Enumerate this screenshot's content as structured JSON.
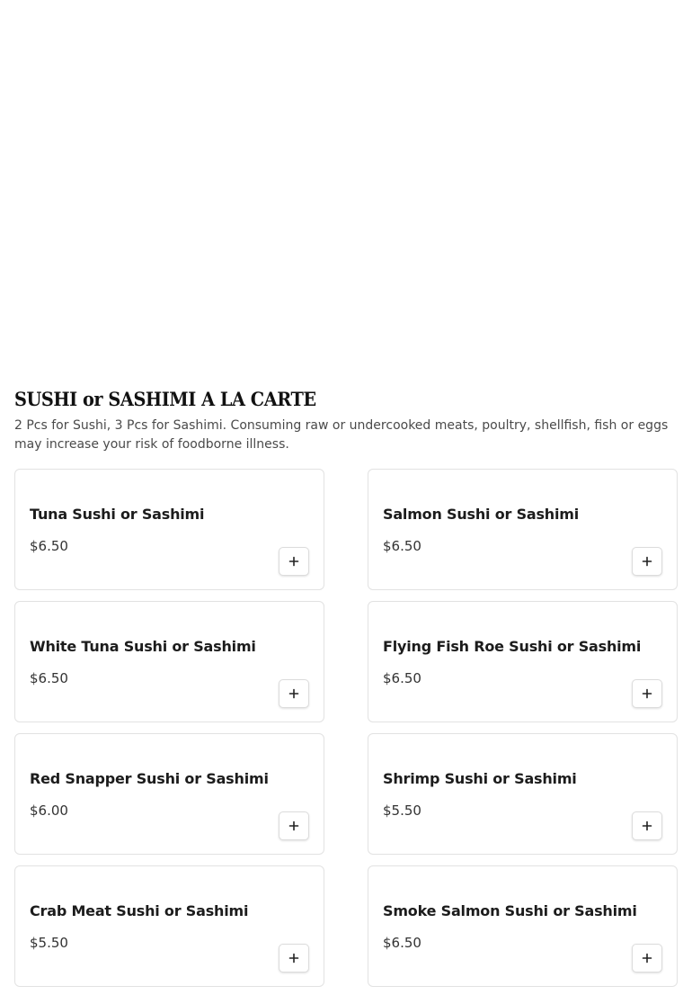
{
  "section": {
    "title": "SUSHI or SASHIMI A LA CARTE",
    "description": "2 Pcs for Sushi, 3 Pcs for Sashimi. Consuming raw or undercooked meats, poultry, shellfish, fish or eggs may increase your risk of foodborne illness."
  },
  "items": [
    {
      "name": "Tuna Sushi or Sashimi",
      "price": "$6.50",
      "action_icon": "plus-icon"
    },
    {
      "name": "Salmon Sushi or Sashimi",
      "price": "$6.50",
      "action_icon": "plus-icon"
    },
    {
      "name": "White Tuna Sushi or Sashimi",
      "price": "$6.50",
      "action_icon": "plus-icon"
    },
    {
      "name": "Flying Fish Roe Sushi or Sashimi",
      "price": "$6.50",
      "action_icon": "plus-icon"
    },
    {
      "name": "Red Snapper Sushi or Sashimi",
      "price": "$6.00",
      "action_icon": "plus-icon"
    },
    {
      "name": "Shrimp Sushi or Sashimi",
      "price": "$5.50",
      "action_icon": "plus-icon"
    },
    {
      "name": "Crab Meat Sushi or Sashimi",
      "price": "$5.50",
      "action_icon": "plus-icon"
    },
    {
      "name": "Smoke Salmon Sushi or Sashimi",
      "price": "$6.50",
      "action_icon": "plus-icon"
    }
  ],
  "colors": {
    "card_border": "#e2e2e2",
    "text_primary": "#1c1c1c",
    "text_secondary": "#4a4a4a"
  }
}
